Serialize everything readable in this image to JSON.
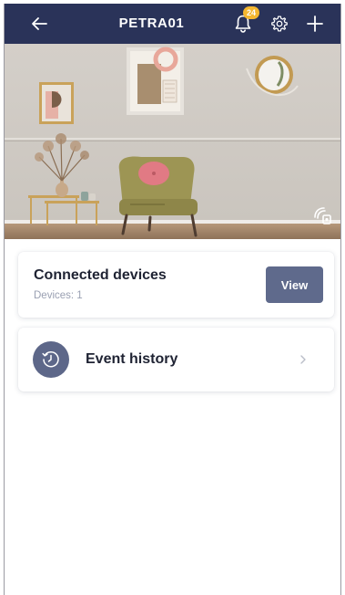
{
  "header": {
    "title": "PETRA01",
    "notification_count": "24",
    "back_icon": "arrow-left-icon",
    "bell_icon": "bell-icon",
    "settings_icon": "gear-icon",
    "add_icon": "plus-icon",
    "background_color": "#2a3359",
    "badge_color": "#f5b730"
  },
  "hero": {
    "photo_mode_icon": "image-mode-icon"
  },
  "devices_card": {
    "title": "Connected devices",
    "count_text": "Devices: 1",
    "view_label": "View",
    "button_color": "#5f6a8c"
  },
  "events_card": {
    "title": "Event history",
    "icon": "history-clock-icon",
    "chevron_icon": "chevron-right-icon"
  }
}
